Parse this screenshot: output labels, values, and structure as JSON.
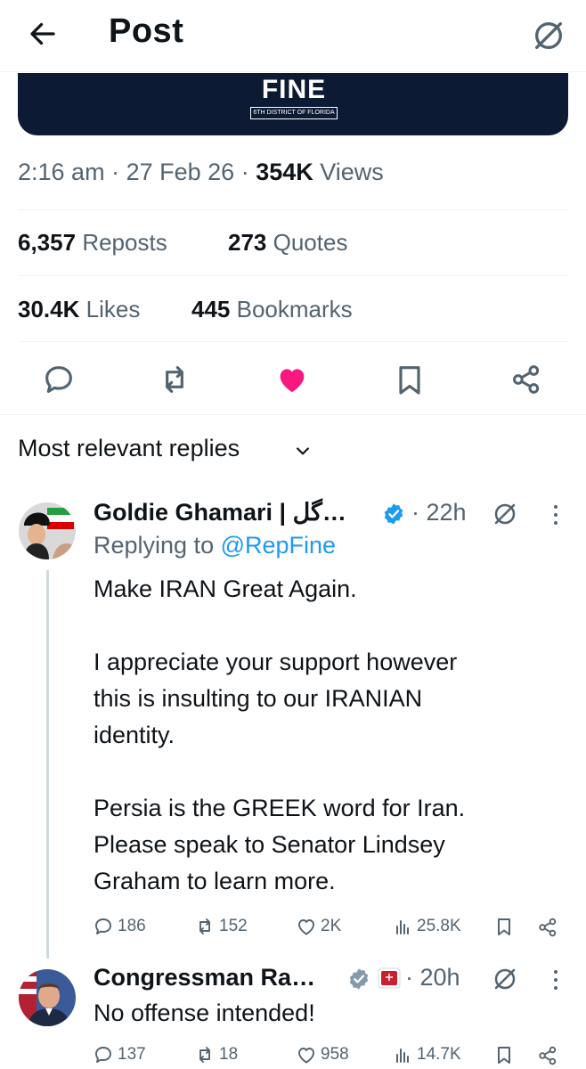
{
  "header": {
    "title": "Post"
  },
  "banner": {
    "logo_text": "FINE",
    "logo_subtext": "6TH DISTRICT OF FLORIDA"
  },
  "post_meta": {
    "time": "2:16 am",
    "date": "27 Feb 26",
    "views_count": "354K",
    "views_label": "Views"
  },
  "stats": {
    "reposts_count": "6,357",
    "reposts_label": "Reposts",
    "quotes_count": "273",
    "quotes_label": "Quotes",
    "likes_count": "30.4K",
    "likes_label": "Likes",
    "bookmarks_count": "445",
    "bookmarks_label": "Bookmarks"
  },
  "actions": [
    "reply-icon",
    "repost-icon",
    "like-icon-filled",
    "bookmark-icon",
    "share-icon"
  ],
  "colors": {
    "like": "#f91880",
    "link": "#1d9bf0",
    "muted": "#536471",
    "banner": "#0c1a33"
  },
  "sort": {
    "label": "Most relevant replies"
  },
  "replies": [
    {
      "name": "Goldie Ghamari | گل…",
      "time": "· 22h",
      "replying_prefix": "Replying to",
      "replying_handle": "@RepFine",
      "body": [
        "Make IRAN Great Again.",
        "",
        "I appreciate your support however",
        "this is insulting to our IRANIAN",
        "identity.",
        "",
        "Persia is the GREEK word for Iran.",
        "Please speak to Senator Lindsey",
        "Graham to learn more."
      ],
      "counts": {
        "replies": "186",
        "reposts": "152",
        "likes": "2K",
        "views": "25.8K"
      }
    },
    {
      "name": "Congressman Ra…",
      "time": "· 20h",
      "body": [
        "No offense intended!"
      ],
      "counts": {
        "replies": "137",
        "reposts": "18",
        "likes": "958",
        "views": "14.7K"
      }
    }
  ]
}
